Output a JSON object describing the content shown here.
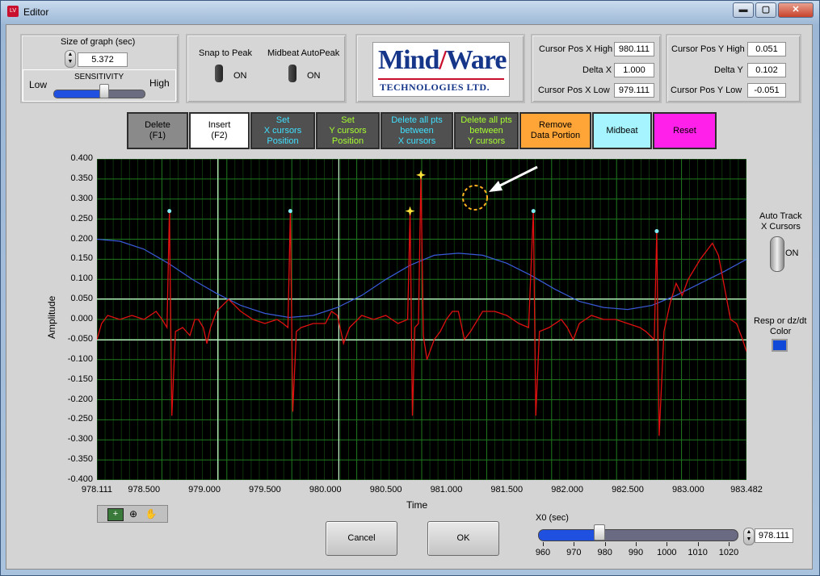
{
  "window": {
    "title": "Editor",
    "minimize": "▬",
    "maximize": "▢",
    "close": "✕"
  },
  "graph_size": {
    "label": "Size of graph (sec)",
    "value": "5.372"
  },
  "sensitivity": {
    "label": "SENSITIVITY",
    "low": "Low",
    "high": "High",
    "level_fraction": 0.55
  },
  "snap": {
    "label": "Snap to Peak",
    "state": "ON"
  },
  "midbeat_autopeak": {
    "label": "Midbeat AutoPeak",
    "state": "ON"
  },
  "logo": {
    "name_a": "Mind",
    "name_b": "Ware",
    "sub": "TECHNOLOGIES LTD."
  },
  "cursor_x": {
    "high_label": "Cursor Pos X High",
    "high": "980.111",
    "delta_label": "Delta X",
    "delta": "1.000",
    "low_label": "Cursor Pos X Low",
    "low": "979.111"
  },
  "cursor_y": {
    "high_label": "Cursor Pos Y High",
    "high": "0.051",
    "delta_label": "Delta Y",
    "delta": "0.102",
    "low_label": "Cursor Pos Y Low",
    "low": "-0.051"
  },
  "toolbar": {
    "delete": "Delete\n(F1)",
    "insert": "Insert\n(F2)",
    "set_x": "Set\nX cursors\nPosition",
    "set_y": "Set\nY cursors\nPosition",
    "del_x": "Delete all pts\nbetween\nX cursors",
    "del_y": "Delete all pts\nbetween\nY cursors",
    "remove": "Remove\nData Portion",
    "midbeat": "Midbeat",
    "reset": "Reset"
  },
  "colors": {
    "grid": "#1f7a1f",
    "ecg": "#e01010",
    "resp": "#3a5ad8",
    "peak": "#7fe8f0",
    "marker": "#ffe23a",
    "cursor": "#c8ffd0"
  },
  "auto_track": {
    "label1": "Auto Track",
    "label2": "X Cursors",
    "state": "ON"
  },
  "resp_color": {
    "label1": "Resp or dz/dt",
    "label2": "Color",
    "swatch": "#1048d8"
  },
  "chart_data": {
    "type": "line",
    "xlabel": "Time",
    "ylabel": "Amplitude",
    "xlim": [
      978.111,
      983.482
    ],
    "ylim": [
      -0.4,
      0.4
    ],
    "x_ticks": [
      "978.111",
      "978.500",
      "979.000",
      "979.500",
      "980.000",
      "980.500",
      "981.000",
      "981.500",
      "982.000",
      "982.500",
      "983.000",
      "983.482"
    ],
    "y_ticks": [
      "0.400",
      "0.350",
      "0.300",
      "0.250",
      "0.200",
      "0.150",
      "0.100",
      "0.050",
      "0.000",
      "-0.050",
      "-0.100",
      "-0.150",
      "-0.200",
      "-0.250",
      "-0.300",
      "-0.350",
      "-0.400"
    ],
    "x_cursors": [
      979.111,
      980.111
    ],
    "y_cursors": [
      0.051,
      -0.051
    ],
    "series": [
      {
        "values": [
          [
            978.111,
            -0.05
          ],
          [
            978.15,
            -0.01
          ],
          [
            978.2,
            0.01
          ],
          [
            978.3,
            0.0
          ],
          [
            978.4,
            0.01
          ],
          [
            978.5,
            0.0
          ],
          [
            978.6,
            0.02
          ],
          [
            978.65,
            0.0
          ],
          [
            978.69,
            -0.02
          ],
          [
            978.71,
            0.27
          ],
          [
            978.73,
            -0.24
          ],
          [
            978.76,
            -0.03
          ],
          [
            978.82,
            -0.02
          ],
          [
            978.88,
            -0.04
          ],
          [
            978.92,
            0.0
          ],
          [
            978.95,
            0.0
          ],
          [
            978.99,
            -0.02
          ],
          [
            979.02,
            -0.06
          ],
          [
            979.05,
            -0.02
          ],
          [
            979.1,
            0.02
          ],
          [
            979.2,
            0.05
          ],
          [
            979.3,
            0.02
          ],
          [
            979.4,
            0.0
          ],
          [
            979.5,
            -0.01
          ],
          [
            979.6,
            0.0
          ],
          [
            979.65,
            -0.01
          ],
          [
            979.69,
            -0.02
          ],
          [
            979.71,
            0.27
          ],
          [
            979.73,
            -0.23
          ],
          [
            979.76,
            -0.03
          ],
          [
            979.8,
            -0.02
          ],
          [
            979.9,
            -0.01
          ],
          [
            980.0,
            -0.01
          ],
          [
            980.05,
            0.02
          ],
          [
            980.1,
            0.01
          ],
          [
            980.15,
            -0.06
          ],
          [
            980.2,
            -0.02
          ],
          [
            980.3,
            0.01
          ],
          [
            980.4,
            0.0
          ],
          [
            980.5,
            0.01
          ],
          [
            980.6,
            -0.01
          ],
          [
            980.68,
            0.0
          ],
          [
            980.7,
            0.27
          ],
          [
            980.72,
            -0.24
          ],
          [
            980.74,
            -0.02
          ],
          [
            980.77,
            -0.01
          ],
          [
            980.79,
            0.36
          ],
          [
            980.81,
            -0.04
          ],
          [
            980.84,
            -0.1
          ],
          [
            980.9,
            -0.05
          ],
          [
            980.95,
            -0.03
          ],
          [
            981.0,
            0.0
          ],
          [
            981.05,
            0.02
          ],
          [
            981.1,
            0.02
          ],
          [
            981.15,
            -0.05
          ],
          [
            981.2,
            -0.03
          ],
          [
            981.3,
            0.02
          ],
          [
            981.4,
            0.02
          ],
          [
            981.5,
            0.01
          ],
          [
            981.6,
            -0.01
          ],
          [
            981.68,
            -0.02
          ],
          [
            981.72,
            0.27
          ],
          [
            981.74,
            -0.24
          ],
          [
            981.77,
            -0.03
          ],
          [
            981.85,
            -0.02
          ],
          [
            981.95,
            0.0
          ],
          [
            982.0,
            -0.02
          ],
          [
            982.05,
            -0.05
          ],
          [
            982.1,
            -0.01
          ],
          [
            982.2,
            0.01
          ],
          [
            982.3,
            0.0
          ],
          [
            982.4,
            0.0
          ],
          [
            982.5,
            -0.01
          ],
          [
            982.6,
            -0.02
          ],
          [
            982.65,
            -0.03
          ],
          [
            982.72,
            -0.05
          ],
          [
            982.74,
            0.22
          ],
          [
            982.76,
            -0.29
          ],
          [
            982.8,
            -0.03
          ],
          [
            982.85,
            0.04
          ],
          [
            982.9,
            0.09
          ],
          [
            982.95,
            0.06
          ],
          [
            983.0,
            0.1
          ],
          [
            983.1,
            0.15
          ],
          [
            983.2,
            0.19
          ],
          [
            983.25,
            0.16
          ],
          [
            983.3,
            0.08
          ],
          [
            983.35,
            0.0
          ],
          [
            983.4,
            -0.01
          ],
          [
            983.45,
            -0.05
          ],
          [
            983.482,
            -0.08
          ]
        ]
      },
      {
        "values": [
          [
            978.111,
            0.2
          ],
          [
            978.3,
            0.195
          ],
          [
            978.5,
            0.175
          ],
          [
            978.7,
            0.14
          ],
          [
            978.9,
            0.1
          ],
          [
            979.1,
            0.065
          ],
          [
            979.3,
            0.035
          ],
          [
            979.5,
            0.015
          ],
          [
            979.7,
            0.005
          ],
          [
            979.9,
            0.01
          ],
          [
            980.1,
            0.03
          ],
          [
            980.3,
            0.06
          ],
          [
            980.5,
            0.1
          ],
          [
            980.7,
            0.135
          ],
          [
            980.9,
            0.16
          ],
          [
            981.1,
            0.165
          ],
          [
            981.3,
            0.16
          ],
          [
            981.5,
            0.14
          ],
          [
            981.7,
            0.11
          ],
          [
            981.9,
            0.075
          ],
          [
            982.1,
            0.045
          ],
          [
            982.3,
            0.03
          ],
          [
            982.5,
            0.025
          ],
          [
            982.7,
            0.035
          ],
          [
            982.9,
            0.06
          ],
          [
            983.1,
            0.09
          ],
          [
            983.3,
            0.12
          ],
          [
            983.482,
            0.15
          ]
        ]
      }
    ],
    "peaks": [
      [
        978.71,
        0.27
      ],
      [
        979.71,
        0.27
      ],
      [
        981.72,
        0.27
      ],
      [
        982.74,
        0.22
      ]
    ],
    "markers": [
      [
        980.7,
        0.27
      ],
      [
        980.79,
        0.36
      ]
    ]
  },
  "x0": {
    "label": "X0 (sec)",
    "value": "978.111",
    "slider_value": 978.111,
    "min": 960,
    "max": 1020,
    "ticks": [
      "960",
      "970",
      "980",
      "990",
      "1000",
      "1010",
      "1020"
    ]
  },
  "buttons": {
    "cancel": "Cancel",
    "ok": "OK"
  }
}
